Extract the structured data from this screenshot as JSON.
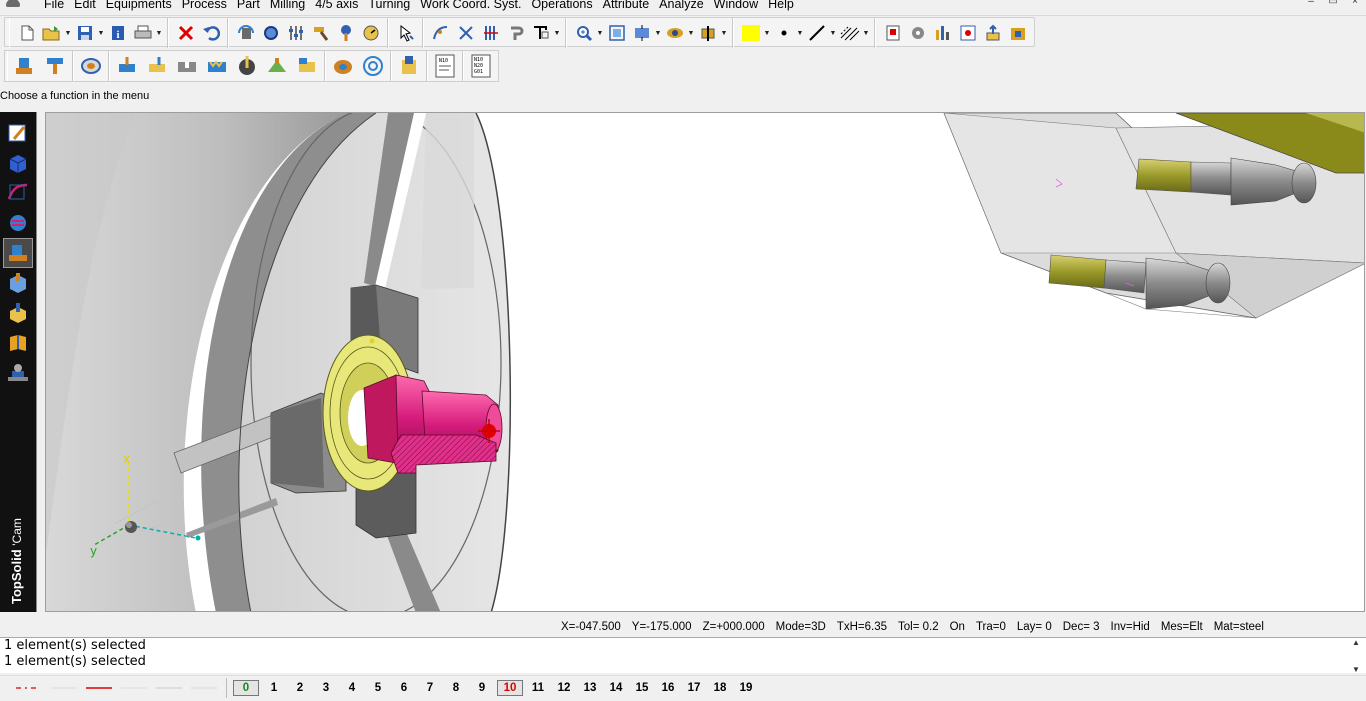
{
  "menu": [
    "File",
    "Edit",
    "Equipments",
    "Process",
    "Part",
    "Milling",
    "4/5 axis",
    "Turning",
    "Work Coord. Syst.",
    "Operations",
    "Attribute",
    "Analyze",
    "Window",
    "Help"
  ],
  "window_controls": [
    "–",
    "▭",
    "×"
  ],
  "toolbar1_icons": [
    "new-icon",
    "open-icon",
    "save-icon",
    "info-icon",
    "print-icon",
    "delete-icon",
    "undo-icon",
    "rotate-icon",
    "zoom-dynamic-icon",
    "sliders-icon",
    "hammer-icon",
    "wrench-icon",
    "gauge-icon",
    "select-icon",
    "curve-edit-icon",
    "scissors-icon",
    "trim-icon",
    "hook-icon",
    "text-icon",
    "zoom-in-icon",
    "zoom-window-icon",
    "pan-icon",
    "view-icon",
    "section-icon",
    "color-icon",
    "point-style-icon",
    "line-style-icon",
    "hatch-icon",
    "report-icon",
    "tools-icon",
    "bars-icon",
    "export-icon",
    "upload-icon",
    "machine-icon"
  ],
  "toolbar2_icons": [
    "turning-icon",
    "fixture-icon",
    "stock-icon",
    "roughing-icon",
    "finishing-icon",
    "grooving-icon",
    "threading-icon",
    "drilling-icon",
    "milling-icon",
    "cutting-icon",
    "boring-icon",
    "target-icon",
    "simulation-icon",
    "nc-file-icon",
    "nc-code-icon"
  ],
  "color_swatch": "#ffff00",
  "hint": "Choose a function in the menu",
  "left_icons": [
    "pencil-icon",
    "solid-icon",
    "surface-icon",
    "layers-icon",
    "lathe-icon",
    "cube-icon",
    "mill-icon",
    "book-icon",
    "robot-icon"
  ],
  "brand": {
    "name": "TopSolid",
    "suffix": "'Cam"
  },
  "axis_labels": {
    "x": "x",
    "y": "y"
  },
  "status": {
    "x": "X=-047.500",
    "y": "Y=-175.000",
    "z": "Z=+000.000",
    "mode": "Mode=3D",
    "txh": "TxH=6.35",
    "tol": "Tol=   0.2",
    "on": "On",
    "tra": "Tra=0",
    "lay": "Lay=  0",
    "dec": "Dec= 3",
    "inv": "Inv=Hid",
    "mes": "Mes=Elt",
    "mat": "Mat=steel"
  },
  "output_lines": [
    "1 element(s) selected",
    "1 element(s) selected"
  ],
  "layers": [
    "0",
    "1",
    "2",
    "3",
    "4",
    "5",
    "6",
    "7",
    "8",
    "9",
    "10",
    "11",
    "12",
    "13",
    "14",
    "15",
    "16",
    "17",
    "18",
    "19"
  ],
  "active_layer": "0",
  "current_layer": "10",
  "colors": {
    "part": "#d81c7a",
    "chuck": "#808080",
    "jaw": "#5a5a5a",
    "tool_holder": "#9a9a2a",
    "ring": "#e6e68a"
  }
}
